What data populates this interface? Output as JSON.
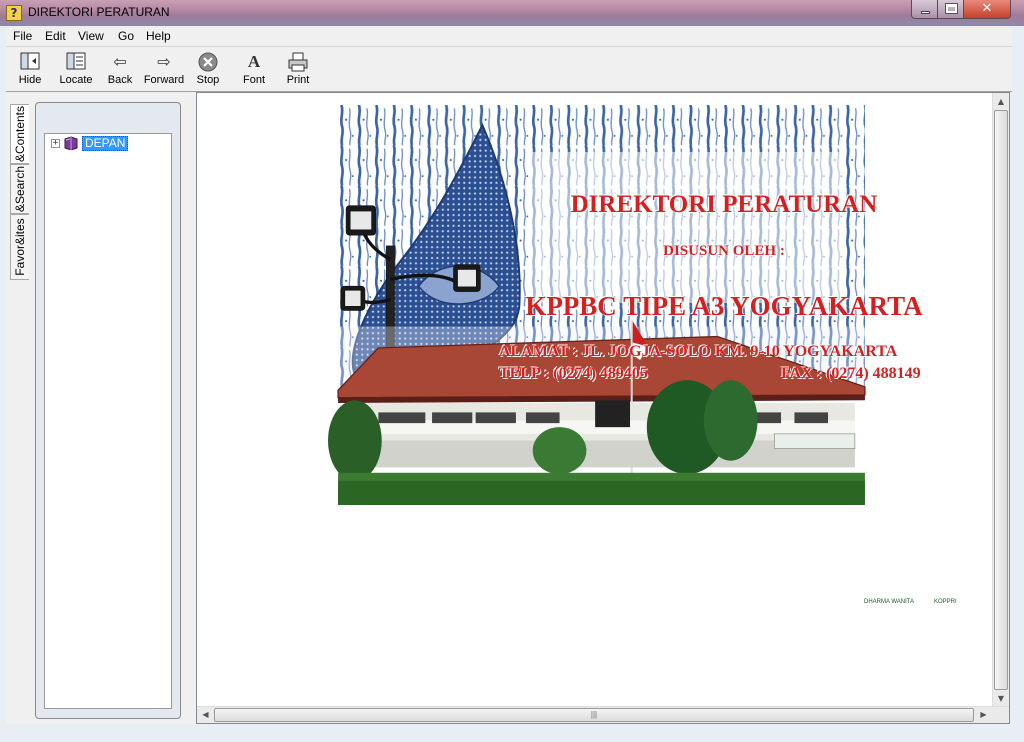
{
  "window": {
    "title": "DIREKTORI PERATURAN",
    "controls": {
      "close": "✕"
    }
  },
  "menu": [
    "File",
    "Edit",
    "View",
    "Go",
    "Help"
  ],
  "toolbar": {
    "hide": "Hide",
    "locate": "Locate",
    "back": "Back",
    "forward": "Forward",
    "stop": "Stop",
    "font": "Font",
    "print": "Print"
  },
  "nav_tabs": {
    "contents": "&Contents",
    "search": "&Search",
    "favorites": "Favor&ites"
  },
  "tree": {
    "expander": "+",
    "items": [
      {
        "label": "DEPAN",
        "selected": true
      }
    ]
  },
  "cover": {
    "title": "DIREKTORI PERATURAN",
    "by": "DISUSUN OLEH :",
    "office": "KPPBC TIPE A3 YOGYAKARTA",
    "address": "ALAMAT : JL. JOGJA-SOLO KM. 9-10 YOGYAKARTA",
    "phone": "TELP : (0274) 489405",
    "fax": "FAX : (0274) 488149",
    "sign_building": "BEA DAN CUKAI",
    "sign_right1": "DHARMA WANITA",
    "sign_right2": "KOPPRI"
  },
  "colors": {
    "headline": "#d42020",
    "selection": "#3399ff",
    "batik": "#3a64a8"
  }
}
